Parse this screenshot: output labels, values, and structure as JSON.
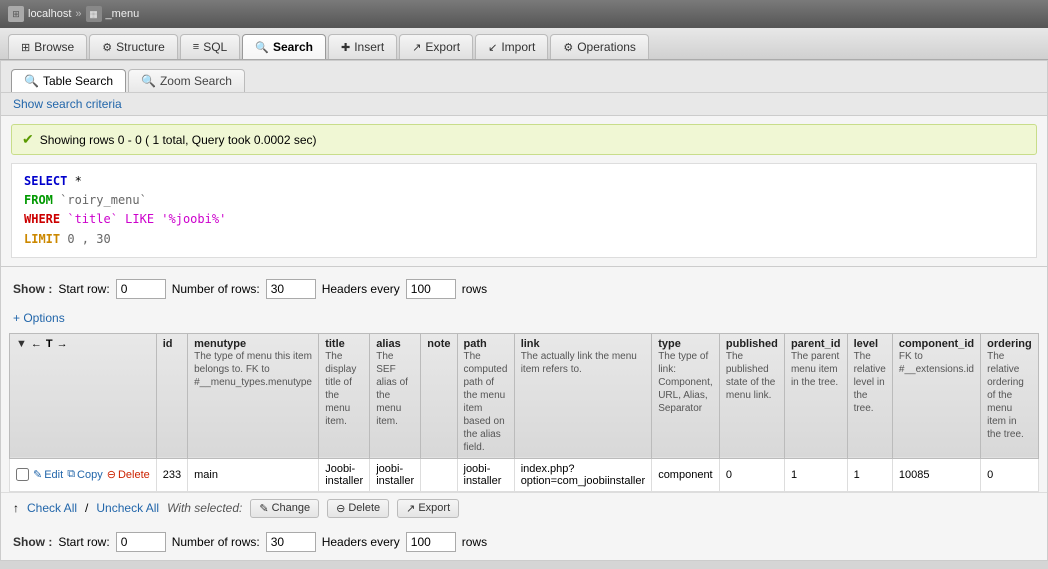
{
  "titlebar": {
    "browser_label": "localhost",
    "separator": "»",
    "db_icon": "▦",
    "menu_label": "_menu"
  },
  "nav_tabs": [
    {
      "id": "browse",
      "label": "Browse",
      "icon": "⊞",
      "active": false
    },
    {
      "id": "structure",
      "label": "Structure",
      "icon": "⚙",
      "active": false
    },
    {
      "id": "sql",
      "label": "SQL",
      "icon": "≡",
      "active": false
    },
    {
      "id": "search",
      "label": "Search",
      "icon": "🔍",
      "active": true
    },
    {
      "id": "insert",
      "label": "Insert",
      "icon": "✚",
      "active": false
    },
    {
      "id": "export",
      "label": "Export",
      "icon": "↗",
      "active": false
    },
    {
      "id": "import",
      "label": "Import",
      "icon": "↙",
      "active": false
    },
    {
      "id": "operations",
      "label": "Operations",
      "icon": "⚙",
      "active": false
    }
  ],
  "sub_tabs": [
    {
      "id": "table-search",
      "label": "Table Search",
      "icon": "🔍",
      "active": true
    },
    {
      "id": "zoom-search",
      "label": "Zoom Search",
      "icon": "🔍",
      "active": false
    }
  ],
  "search_criteria_link": "Show search criteria",
  "success_message": "Showing rows 0 - 0 ( 1 total, Query took 0.0002 sec)",
  "sql": {
    "select": "SELECT *",
    "from_keyword": "FROM",
    "table": "`roiry_menu`",
    "where_keyword": "WHERE",
    "condition": "`title` LIKE '%joobi%'",
    "limit_keyword": "LIMIT",
    "limit_values": "0 , 30"
  },
  "show_controls": {
    "label": "Show :",
    "start_row_label": "Start row:",
    "start_row_value": "0",
    "num_rows_label": "Number of rows:",
    "num_rows_value": "30",
    "headers_label": "Headers every",
    "headers_value": "100",
    "rows_label": "rows"
  },
  "options_label": "+ Options",
  "table_nav": {
    "left_arrow": "←",
    "t_label": "T",
    "right_arrow": "→",
    "sort_icon": "▼"
  },
  "columns": [
    {
      "name": "id",
      "desc": ""
    },
    {
      "name": "menutype",
      "desc": "The type of menu this item belongs to. FK to #__menu_types.menutype"
    },
    {
      "name": "title",
      "desc": "The display title of the menu item."
    },
    {
      "name": "alias",
      "desc": "The SEF alias of the menu item."
    },
    {
      "name": "note",
      "desc": ""
    },
    {
      "name": "path",
      "desc": "The computed path of the menu item based on the alias field."
    },
    {
      "name": "link",
      "desc": "The actually link the menu item refers to."
    },
    {
      "name": "type",
      "desc": "The type of link: Component, URL, Alias, Separator"
    },
    {
      "name": "published",
      "desc": "The published state of the menu link."
    },
    {
      "name": "parent_id",
      "desc": "The parent menu item in the tree."
    },
    {
      "name": "level",
      "desc": "The relative level in the tree."
    },
    {
      "name": "component_id",
      "desc": "FK to #__extensions.id"
    },
    {
      "name": "ordering",
      "desc": "The relative ordering of the menu item in the tree."
    }
  ],
  "rows": [
    {
      "checkbox": false,
      "edit_label": "Edit",
      "copy_label": "Copy",
      "delete_label": "Delete",
      "id": "233",
      "menutype": "main",
      "title": "Joobi-installer",
      "alias": "joobi-installer",
      "note": "",
      "path": "joobi-installer",
      "link": "index.php?option=com_joobiinstaller",
      "type": "component",
      "published": "0",
      "parent_id": "1",
      "level": "1",
      "component_id": "10085",
      "ordering": "0"
    }
  ],
  "bottom_controls": {
    "check_all": "Check All",
    "uncheck_all": "Uncheck All",
    "separator": "/",
    "with_selected": "With selected:",
    "change_label": "Change",
    "delete_label": "Delete",
    "export_label": "Export"
  },
  "bottom_show": {
    "label": "Show :",
    "start_row_label": "Start row:",
    "start_row_value": "0",
    "num_rows_label": "Number of rows:",
    "num_rows_value": "30",
    "headers_label": "Headers every",
    "headers_value": "100",
    "rows_label": "rows"
  }
}
